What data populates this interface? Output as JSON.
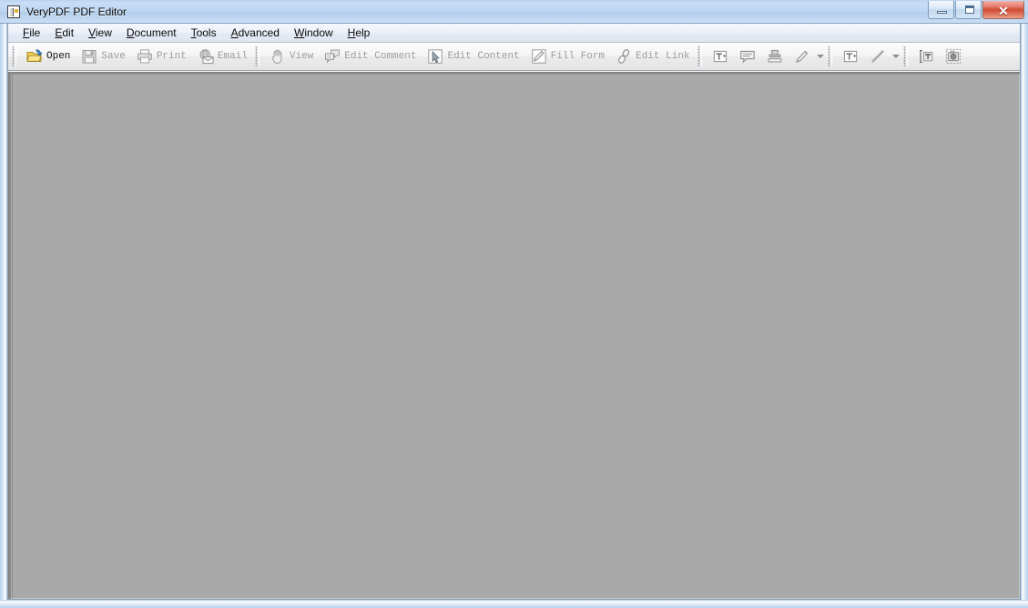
{
  "window": {
    "title": "VeryPDF PDF Editor",
    "icon": "app-book-icon",
    "controls": {
      "minimize": "minimize-button",
      "maximize": "maximize-button",
      "close_glyph": "✕"
    }
  },
  "menubar": {
    "items": [
      {
        "label": "File",
        "mnemonic": "F"
      },
      {
        "label": "Edit",
        "mnemonic": "E"
      },
      {
        "label": "View",
        "mnemonic": "V"
      },
      {
        "label": "Document",
        "mnemonic": "D"
      },
      {
        "label": "Tools",
        "mnemonic": "T"
      },
      {
        "label": "Advanced",
        "mnemonic": "A"
      },
      {
        "label": "Window",
        "mnemonic": "W"
      },
      {
        "label": "Help",
        "mnemonic": "H"
      }
    ]
  },
  "toolbar": {
    "groups": [
      {
        "buttons": [
          {
            "label": "Open",
            "icon": "open-folder-icon",
            "enabled": true
          },
          {
            "label": "Save",
            "icon": "floppy-disk-icon",
            "enabled": false
          },
          {
            "label": "Print",
            "icon": "printer-icon",
            "enabled": false
          },
          {
            "label": "Email",
            "icon": "email-envelope-icon",
            "enabled": false
          }
        ]
      },
      {
        "buttons": [
          {
            "label": "View",
            "icon": "hand-icon",
            "enabled": false
          },
          {
            "label": "Edit Comment",
            "icon": "comment-bubbles-icon",
            "enabled": false
          },
          {
            "label": "Edit Content",
            "icon": "select-arrow-icon",
            "enabled": false
          },
          {
            "label": "Fill Form",
            "icon": "form-pen-icon",
            "enabled": false
          },
          {
            "label": "Edit Link",
            "icon": "link-chain-icon",
            "enabled": false
          }
        ]
      },
      {
        "buttons": [
          {
            "label": "",
            "icon": "text-box-add-icon",
            "enabled": false
          },
          {
            "label": "",
            "icon": "sticky-note-icon",
            "enabled": false
          },
          {
            "label": "",
            "icon": "stamp-icon",
            "enabled": false
          },
          {
            "label": "",
            "icon": "pencil-icon",
            "enabled": false
          }
        ],
        "dropdown": "pencil-dropdown-caret"
      },
      {
        "buttons": [
          {
            "label": "",
            "icon": "typewriter-text-icon",
            "enabled": false
          },
          {
            "label": "",
            "icon": "line-tool-icon",
            "enabled": false
          }
        ],
        "dropdown": "line-dropdown-caret"
      },
      {
        "buttons": [
          {
            "label": "",
            "icon": "text-select-icon",
            "enabled": false
          },
          {
            "label": "",
            "icon": "snapshot-icon",
            "enabled": false
          }
        ]
      }
    ]
  },
  "workspace": {
    "state": "empty-document-area",
    "background_color": "#a9a9a9"
  },
  "colors": {
    "titlebar_start": "#b9d3ef",
    "titlebar_end": "#d9e8f8",
    "close_button": "#cf4a33",
    "workspace": "#a9a9a9",
    "menubar": "#eef2f9",
    "toolbar": "#f4f4f4",
    "disabled_text": "#9c9c9c"
  }
}
